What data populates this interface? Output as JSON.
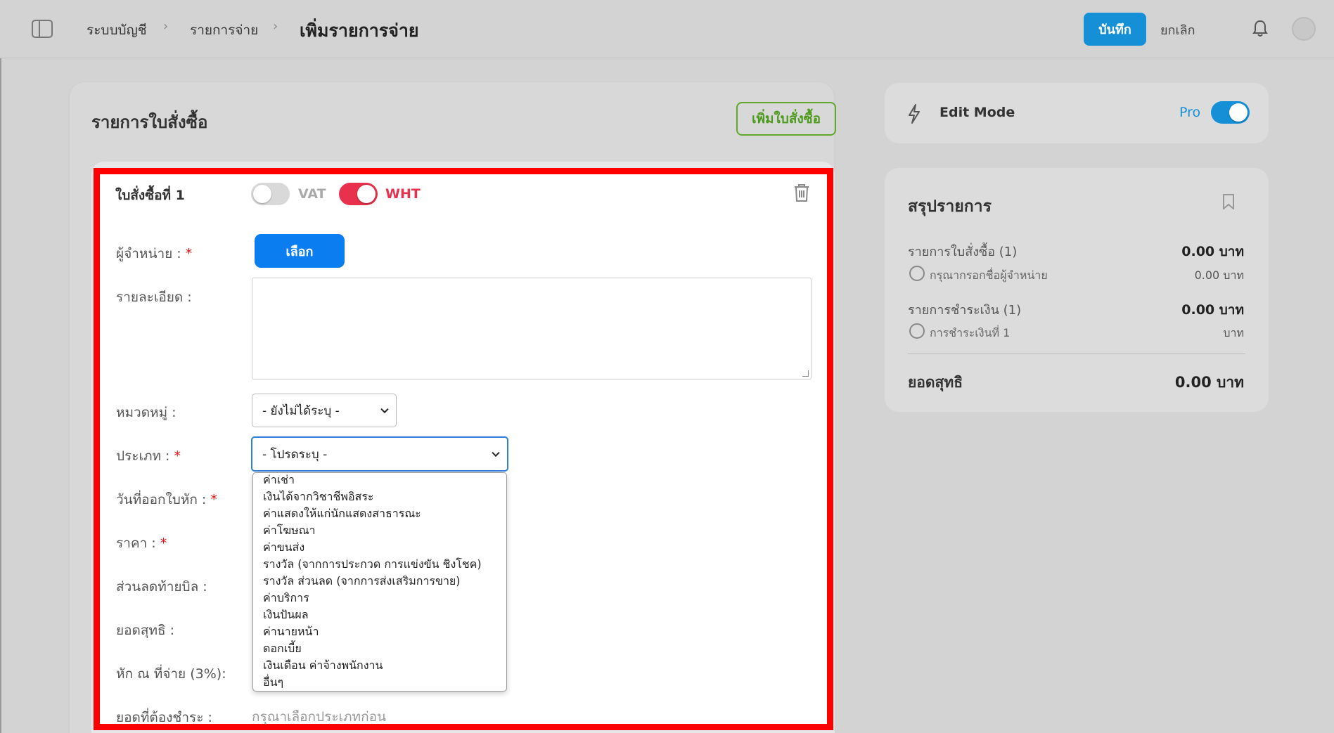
{
  "breadcrumb": {
    "root": "ระบบบัญชี",
    "parent": "รายการจ่าย",
    "sep": "›"
  },
  "page_title": "เพิ่มรายการจ่าย",
  "header": {
    "save_label": "บันทึก",
    "cancel_label": "ยกเลิก"
  },
  "main": {
    "section_title": "รายการใบสั่งซื้อ",
    "add_po_label": "เพิ่มใบสั่งซื้อ",
    "po": {
      "title": "ใบสั่งซื้อที่ 1",
      "vat_label": "VAT",
      "vat_on": false,
      "wht_label": "WHT",
      "wht_on": true,
      "fields": {
        "vendor": "ผู้จำหน่าย :",
        "details": "รายละเอียด :",
        "category": "หมวดหมู่ :",
        "type": "ประเภท :",
        "issue_date": "วันที่ออกใบหัก :",
        "price": "ราคา :",
        "discount": "ส่วนลดท้ายบิล :",
        "net": "ยอดสุทธิ :",
        "wht": "หัก ณ ที่จ่าย (3%):",
        "payable": "ยอดที่ต้องชำระ :"
      },
      "required_mark": "*",
      "pick_label": "เลือก",
      "category_value": "- ยังไม่ได้ระบุ -",
      "type_value": "- โปรดระบุ -",
      "type_options": [
        "ค่าเช่า",
        "เงินได้จากวิชาชีพอิสระ",
        "ค่าแสดงให้แก่นักแสดงสาธารณะ",
        "ค่าโฆษณา",
        "ค่าขนส่ง",
        "รางวัล (จากการประกวด การแข่งขัน ชิงโชค)",
        "รางวัล ส่วนลด (จากการส่งเสริมการขาย)",
        "ค่าบริการ",
        "เงินปันผล",
        "ค่านายหน้า",
        "ดอกเบี้ย",
        "เงินเดือน ค่าจ้างพนักงาน",
        "อื่นๆ"
      ],
      "payable_hint": "กรุณาเลือกประเภทก่อน"
    }
  },
  "edit_mode": {
    "label": "Edit Mode",
    "pro_label": "Pro",
    "on": true
  },
  "summary": {
    "title": "สรุปรายการ",
    "po_label": "รายการใบสั่งซื้อ (1)",
    "po_value": "0.00 บาท",
    "po_sub_label": "กรุณากรอกชื่อผู้จำหน่าย",
    "po_sub_value": "0.00 บาท",
    "pay_label": "รายการชำระเงิน (1)",
    "pay_value": "0.00 บาท",
    "pay_sub_label": "การชำระเงินที่ 1",
    "pay_sub_value": "บาท",
    "net_label": "ยอดสุทธิ",
    "net_value": "0.00 บาท"
  },
  "icons": [
    "sidebar-toggle-icon",
    "chevron-right-icon",
    "bell-icon",
    "trash-icon",
    "bolt-icon",
    "bookmark-icon",
    "chevron-down-icon"
  ],
  "colors": {
    "primary": "#1590d6",
    "pick_button": "#0a7ef0",
    "add_po": "#5fa82c",
    "wht": "#e8314c",
    "highlight": "#ff0000"
  }
}
